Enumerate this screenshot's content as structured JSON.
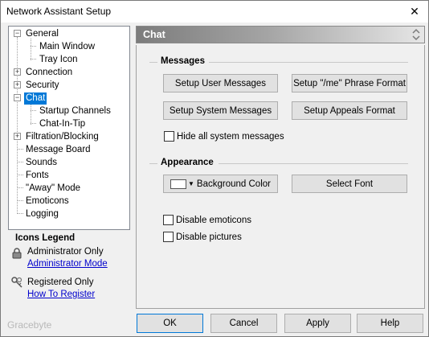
{
  "window": {
    "title": "Network Assistant Setup",
    "close_glyph": "✕"
  },
  "tree": {
    "items": [
      {
        "label": "General",
        "expander": "−"
      },
      {
        "label": "Main Window"
      },
      {
        "label": "Tray Icon"
      },
      {
        "label": "Connection",
        "expander": "+"
      },
      {
        "label": "Security",
        "expander": "+"
      },
      {
        "label": "Chat",
        "expander": "−",
        "selected": true
      },
      {
        "label": "Startup Channels"
      },
      {
        "label": "Chat-In-Tip"
      },
      {
        "label": "Filtration/Blocking",
        "expander": "+"
      },
      {
        "label": "Message Board"
      },
      {
        "label": "Sounds"
      },
      {
        "label": "Fonts"
      },
      {
        "label": "\"Away\" Mode"
      },
      {
        "label": "Emoticons"
      },
      {
        "label": "Logging"
      }
    ]
  },
  "legend": {
    "title": "Icons Legend",
    "admin_text": "Administrator Only",
    "admin_link": "Administrator Mode",
    "reg_text": "Registered Only",
    "reg_link": "How To Register",
    "admin_icon": "padlock-icon",
    "reg_icon": "keys-icon"
  },
  "header": {
    "title": "Chat",
    "arrows_icon": "up-down-chevron-icon"
  },
  "messages": {
    "title": "Messages",
    "setup_user": "Setup User Messages",
    "setup_me": "Setup \"/me\" Phrase Format",
    "setup_system": "Setup System Messages",
    "setup_appeals": "Setup Appeals Format",
    "hide_system": "Hide all system messages"
  },
  "appearance": {
    "title": "Appearance",
    "bg_color": "Background Color",
    "select_font": "Select Font",
    "disable_emoticons": "Disable emoticons",
    "disable_pictures": "Disable pictures"
  },
  "footer": {
    "ok": "OK",
    "cancel": "Cancel",
    "apply": "Apply",
    "help": "Help"
  },
  "watermark": "Gracebyte",
  "colors": {
    "selection": "#0078d7",
    "link": "#0000cc",
    "header_dark": "#7c7c7c"
  }
}
